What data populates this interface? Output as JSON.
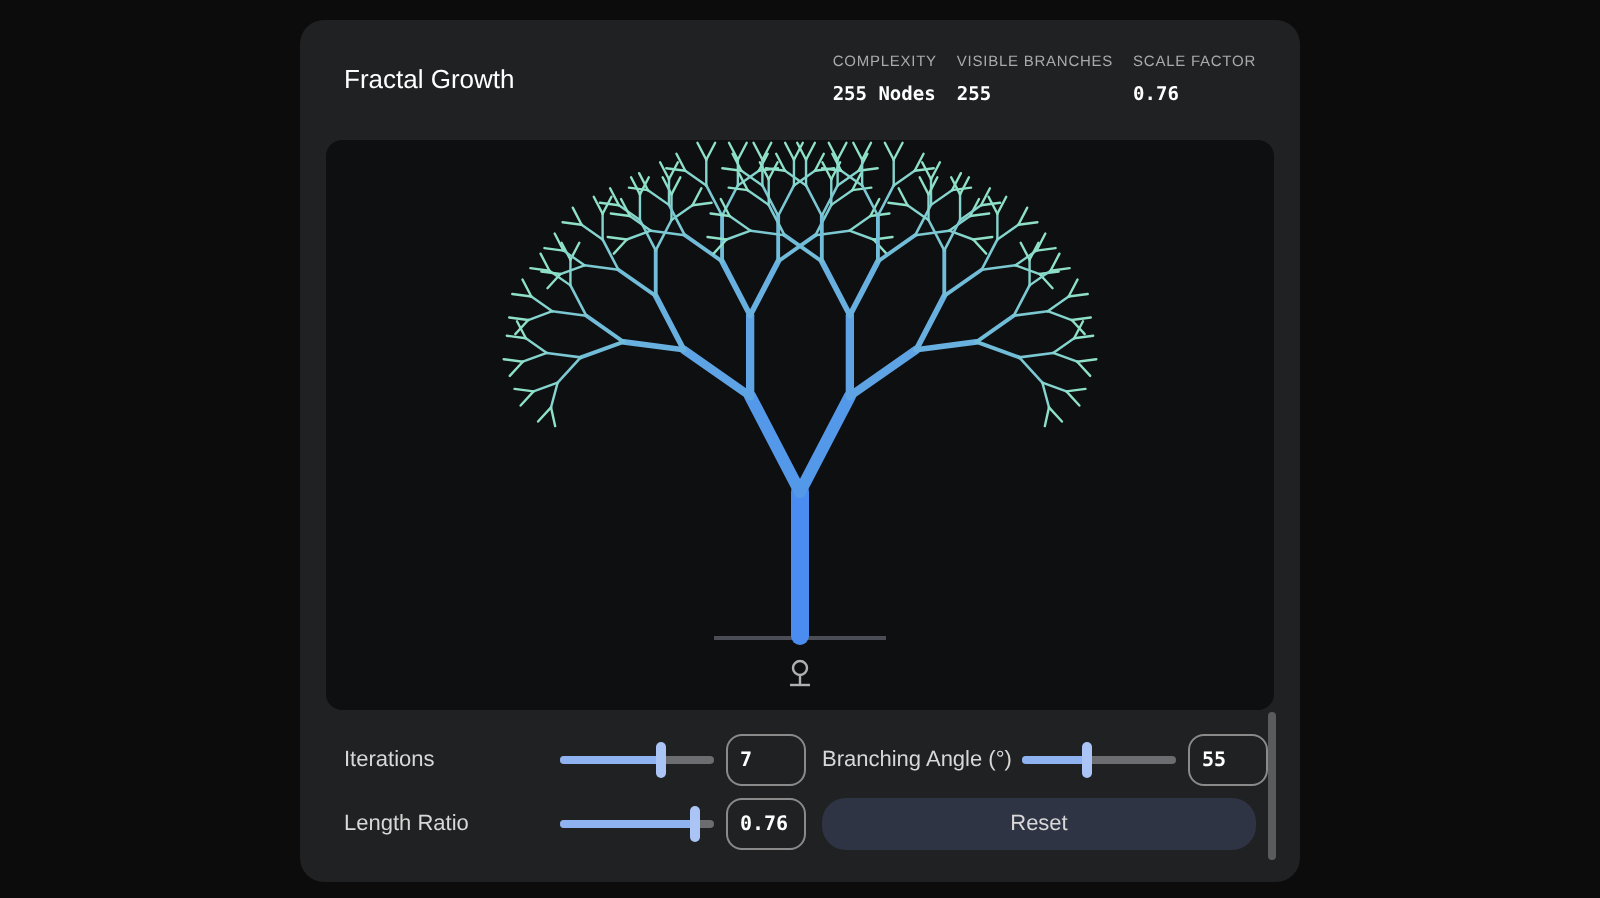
{
  "title": "Fractal Growth",
  "stats": [
    {
      "label": "COMPLEXITY",
      "value": "255 Nodes"
    },
    {
      "label": "VISIBLE BRANCHES",
      "value": "255"
    },
    {
      "label": "SCALE FACTOR",
      "value": "0.76"
    }
  ],
  "controls": [
    {
      "kind": "slider",
      "label": "Iterations",
      "level": 0.66,
      "value": "7"
    },
    {
      "kind": "slider",
      "label": "Branching Angle (°)",
      "level": 0.42,
      "value": "55"
    },
    {
      "kind": "slider",
      "label": "Length Ratio",
      "level": 0.88,
      "value": "0.76"
    },
    {
      "kind": "button",
      "label": "Reset"
    }
  ]
}
